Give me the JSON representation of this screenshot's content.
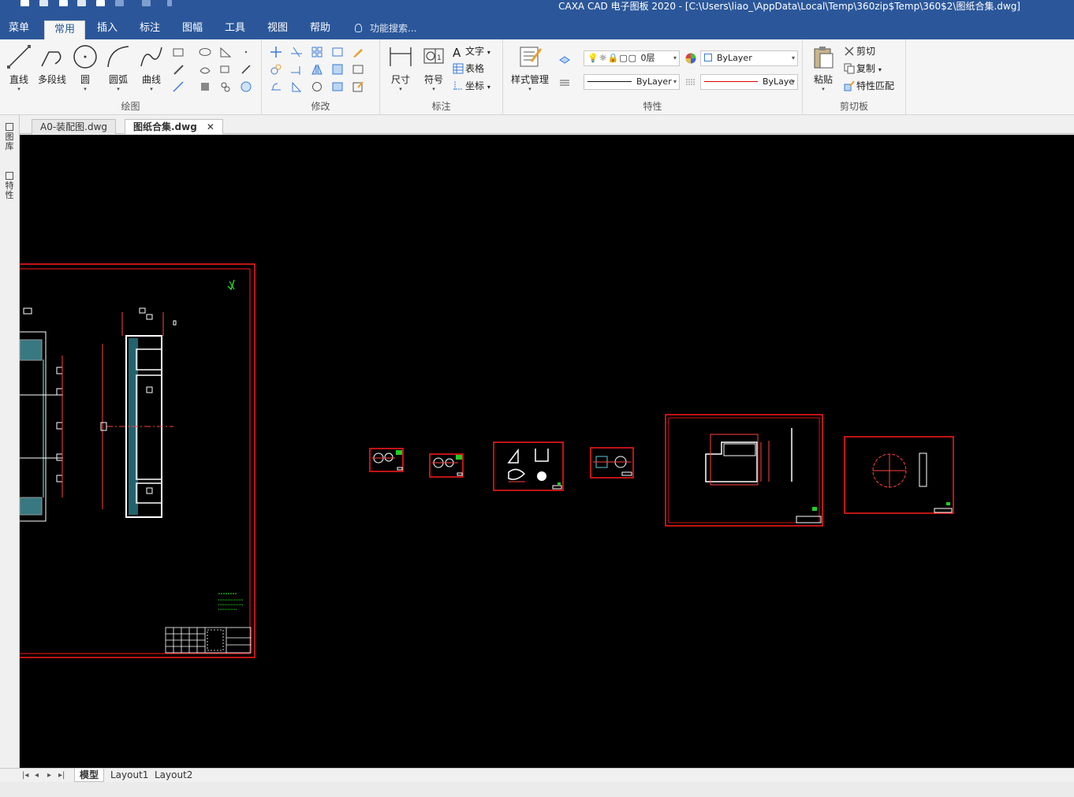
{
  "window": {
    "title": "CAXA CAD 电子图板 2020 - [C:\\Users\\liao_\\AppData\\Local\\Temp\\360zip$Temp\\360$2\\图纸合集.dwg]"
  },
  "menu": {
    "items": [
      "菜单",
      "常用",
      "插入",
      "标注",
      "图幅",
      "工具",
      "视图",
      "帮助"
    ],
    "active": "常用",
    "search_placeholder": "功能搜索..."
  },
  "ribbon": {
    "draw": {
      "label": "绘图",
      "buttons": [
        "直线",
        "多段线",
        "圆",
        "圆弧",
        "曲线"
      ]
    },
    "modify": {
      "label": "修改"
    },
    "annotate": {
      "label": "标注",
      "buttons": [
        "尺寸",
        "符号"
      ],
      "small": [
        "文字",
        "表格",
        "坐标"
      ]
    },
    "properties": {
      "label": "特性",
      "style_manager": "样式管理",
      "layer": "0层",
      "color": "ByLayer",
      "linetype": "ByLayer",
      "lineweight": "ByLaye"
    },
    "clipboard": {
      "label": "剪切板",
      "paste": "粘贴",
      "small": [
        "剪切",
        "复制",
        "特性匹配"
      ]
    }
  },
  "doc_tabs": [
    {
      "label": "A0-装配图.dwg",
      "active": false
    },
    {
      "label": "图纸合集.dwg",
      "active": true
    }
  ],
  "side_tabs": [
    "图库",
    "特性"
  ],
  "layout_tabs": [
    "模型",
    "Layout1",
    "Layout2"
  ],
  "colors": {
    "ribbon_blue": "#2b579a",
    "frame_red": "#ff1a1a",
    "outline_white": "#ffffff",
    "hatch_cyan": "#7ff0ff",
    "note_green": "#22ff22",
    "canvas": "#000000"
  }
}
